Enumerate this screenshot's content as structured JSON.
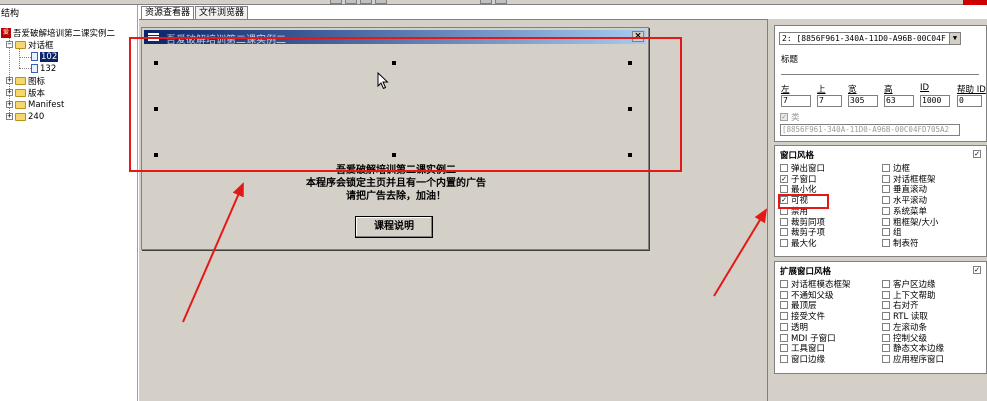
{
  "tree": {
    "title": "结构",
    "nodes": [
      {
        "label": "吾爱破解培训第二课实例二",
        "icon": "app-icon"
      },
      {
        "label": "对话框",
        "icon": "folder-icon",
        "expander": "−"
      },
      {
        "label": "102",
        "icon": "file-icon",
        "selected": true
      },
      {
        "label": "132",
        "icon": "file-icon"
      },
      {
        "label": "图标",
        "icon": "folder-icon",
        "expander": "+"
      },
      {
        "label": "版本",
        "icon": "folder-icon",
        "expander": "+"
      },
      {
        "label": "Manifest",
        "icon": "folder-icon",
        "expander": "+"
      },
      {
        "label": "240",
        "icon": "folder-icon",
        "expander": "+"
      }
    ]
  },
  "tabs": [
    {
      "label": "资源查看器",
      "active": true
    },
    {
      "label": "文件浏览器",
      "active": false
    }
  ],
  "dialog": {
    "title": "吾爱破解培训第二课实例二",
    "close_glyph": "×",
    "lines": [
      "吾爱破解培训第二课实例二",
      "本程序会锁定主页并且有一个内置的广告",
      "请把广告去除，加油！"
    ],
    "button_label": "课程说明"
  },
  "props": {
    "control_combo": "2: [8856F961-340A-11D0-A96B-00C04F",
    "caption_label": "标题",
    "pos_labels": [
      "左",
      "上",
      "宽",
      "高",
      "ID",
      "帮助 ID"
    ],
    "pos_values": [
      "7",
      "7",
      "305",
      "63",
      "1000",
      "0"
    ],
    "class_label": "类",
    "class_value": "[8856F961-340A-11D0-A96B-00C04FD705A2",
    "window_style": {
      "title": "窗口风格",
      "left": [
        {
          "label": "弹出窗口",
          "checked": false
        },
        {
          "label": "子窗口",
          "checked": true
        },
        {
          "label": "最小化",
          "checked": false
        },
        {
          "label": "可视",
          "checked": true
        },
        {
          "label": "禁用",
          "checked": false
        },
        {
          "label": "裁剪同项",
          "checked": false
        },
        {
          "label": "裁剪子项",
          "checked": false
        },
        {
          "label": "最大化",
          "checked": false
        }
      ],
      "right": [
        {
          "label": "边框",
          "checked": false
        },
        {
          "label": "对话框框架",
          "checked": false
        },
        {
          "label": "垂直滚动",
          "checked": false
        },
        {
          "label": "水平滚动",
          "checked": false
        },
        {
          "label": "系统菜单",
          "checked": false
        },
        {
          "label": "粗框架/大小",
          "checked": false
        },
        {
          "label": "组",
          "checked": false
        },
        {
          "label": "制表符",
          "checked": false
        }
      ]
    },
    "ext_style": {
      "title": "扩展窗口风格",
      "left": [
        {
          "label": "对话框模态框架",
          "checked": false
        },
        {
          "label": "不通知父级",
          "checked": false
        },
        {
          "label": "最顶层",
          "checked": false
        },
        {
          "label": "接受文件",
          "checked": false
        },
        {
          "label": "透明",
          "checked": false
        },
        {
          "label": "MDI 子窗口",
          "checked": false
        },
        {
          "label": "工具窗口",
          "checked": false
        },
        {
          "label": "窗口边缘",
          "checked": false
        }
      ],
      "right": [
        {
          "label": "客户区边缘",
          "checked": false
        },
        {
          "label": "上下文帮助",
          "checked": false
        },
        {
          "label": "右对齐",
          "checked": false
        },
        {
          "label": "RTL 读取",
          "checked": false
        },
        {
          "label": "左滚动条",
          "checked": false
        },
        {
          "label": "控制父级",
          "checked": false
        },
        {
          "label": "静态文本边缘",
          "checked": false
        },
        {
          "label": "应用程序窗口",
          "checked": false
        }
      ]
    }
  },
  "colors": {
    "annotation_red": "#e51818",
    "title_bar": "#0a246a",
    "selection": "#0a246a"
  }
}
